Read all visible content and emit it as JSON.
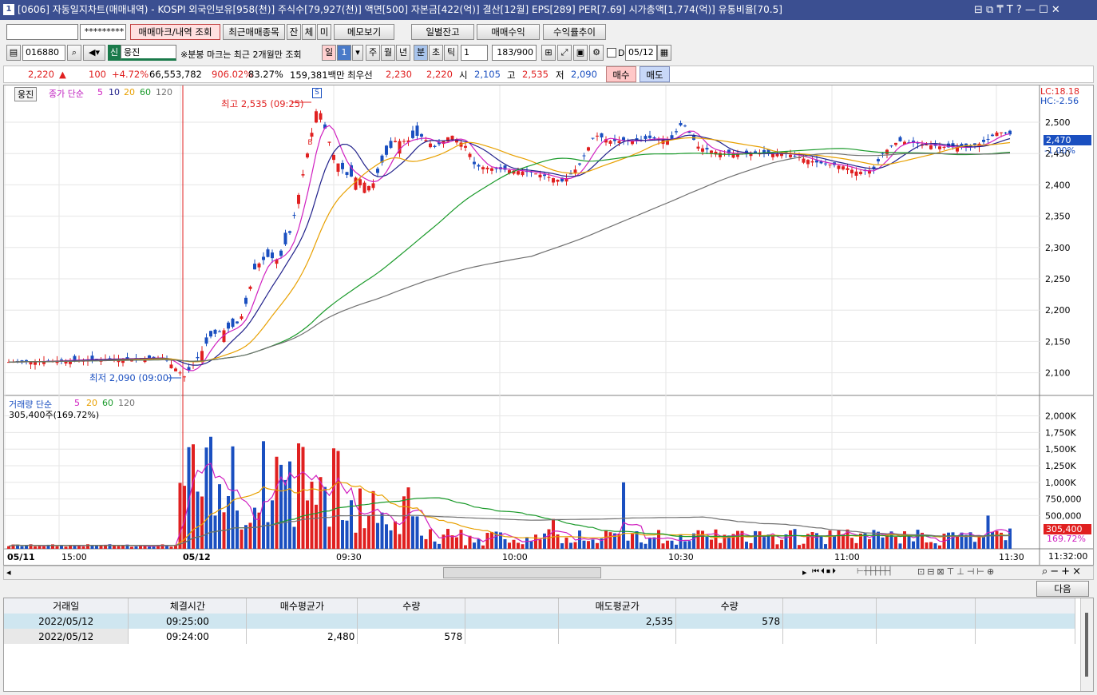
{
  "title": {
    "num": "1",
    "text": "[0606] 자동일지차트(매매내역) - KOSPI 외국인보유[958(천)] 주식수[79,927(천)] 액면[500] 자본금[422(억)] 결산[12월] EPS[289] PER[7.69] 시가총액[1,774(억)] 유통비율[70.5]",
    "controls": "⊟ ⧉ ₸ T ?  —  ☐  ✕"
  },
  "toolbar1": {
    "account_value": "",
    "password_value": "*********",
    "btn_mark": "매매마크/내역 조회",
    "btn_recent": "최근매매종목",
    "btn_jan": "잔",
    "btn_che": "체",
    "btn_mi": "미",
    "btn_memo": "메모보기",
    "btn_daily": "일별잔고",
    "btn_profit": "매매수익",
    "btn_rate": "수익률추이",
    "btn_next": "다음"
  },
  "toolbar2": {
    "code": "016880",
    "badge": "신",
    "name": "웅진",
    "note": "※분봉 마크는 최근 2개월만 조회",
    "periods": [
      "일",
      "1",
      "주",
      "월",
      "년",
      "분",
      "초",
      "틱"
    ],
    "interval": "1",
    "count": "183/900",
    "date_checkbox": "D",
    "date": "05/12"
  },
  "quote": {
    "price": "2,220",
    "arrow": "▲",
    "change": "100",
    "rate": "+4.72%",
    "volume": "66,553,782",
    "vol_ratio": "906.02%",
    "rot": "83.27%",
    "amount": "159,381백만",
    "best_label": "최우선",
    "bid": "2,230",
    "ask": "2,220",
    "open_label": "시",
    "open": "2,105",
    "high_label": "고",
    "high": "2,535",
    "low_label": "저",
    "low": "2,090",
    "buy": "매수",
    "sell": "매도"
  },
  "chart": {
    "stock_tag": "웅진",
    "price_legend": {
      "label": "종가 단순",
      "ma": [
        "5",
        "10",
        "20",
        "60",
        "120"
      ]
    },
    "lc": "LC:18.18",
    "hc": "HC:-2.56",
    "cur_price": "2,470",
    "cur_rate": "-1.00%",
    "high_mark": "최고 2,535 (09:25)",
    "low_mark": "최저 2,090 (09:00)",
    "sell_mark": "S",
    "buy_mark": "B",
    "price_ticks": [
      "2,500",
      "2,450",
      "2,400",
      "2,350",
      "2,300",
      "2,250",
      "2,200",
      "2,150",
      "2,100"
    ],
    "vol_legend": {
      "label": "거래량 단순",
      "ma": [
        "5",
        "20",
        "60",
        "120"
      ]
    },
    "vol_value": "305,400주(169.72%)",
    "vol_ticks": [
      "2,000K",
      "1,750K",
      "1,500K",
      "1,250K",
      "1,000K",
      "750,000",
      "500,000"
    ],
    "vol_cur": "305,400",
    "vol_rate": "169.72%",
    "time_labels": [
      "05/11",
      "15:00",
      "05/12",
      "09:30",
      "10:00",
      "10:30",
      "11:00",
      "11:30"
    ],
    "time_end": "11:32:00",
    "colors": {
      "up": "#e02020",
      "down": "#1a4fc0",
      "ma5": "#d020c0",
      "ma10": "#20208a",
      "ma20": "#e8a000",
      "ma60": "#1a9a2a",
      "ma120": "#707070"
    }
  },
  "table": {
    "headers": [
      "거래일",
      "체결시간",
      "매수평균가",
      "수량",
      "",
      "매도평균가",
      "수량",
      "",
      "",
      ""
    ],
    "rows": [
      [
        "2022/05/12",
        "09:25:00",
        "",
        "",
        "",
        "2,535",
        "578",
        "",
        "",
        ""
      ],
      [
        "2022/05/12",
        "09:24:00",
        "2,480",
        "578",
        "",
        "",
        "",
        "",
        "",
        ""
      ]
    ]
  }
}
